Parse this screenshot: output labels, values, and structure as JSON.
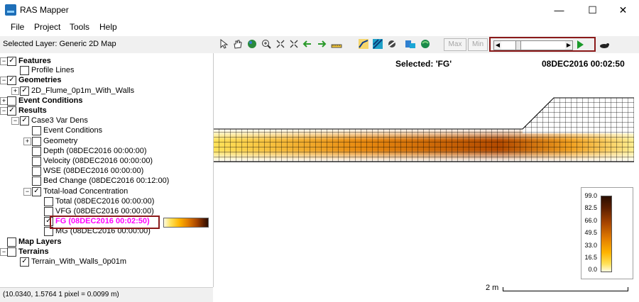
{
  "window": {
    "title": "RAS Mapper",
    "minimize": "—",
    "maximize": "☐",
    "close": "✕"
  },
  "menu": [
    "File",
    "Project",
    "Tools",
    "Help"
  ],
  "toolbar": {
    "selected_layer": "Selected Layer: Generic 2D Map",
    "max_label": "Max",
    "min_label": "Min"
  },
  "tree": [
    {
      "label": "Features",
      "bold": true,
      "checked": true,
      "expander": "−"
    },
    {
      "label": "Profile Lines",
      "bold": false,
      "checked": false,
      "expander": ""
    },
    {
      "label": "Geometries",
      "bold": true,
      "checked": true,
      "expander": "−"
    },
    {
      "label": "2D_Flume_0p1m_With_Walls",
      "bold": false,
      "checked": true,
      "expander": "+"
    },
    {
      "label": "Event Conditions",
      "bold": true,
      "checked": false,
      "expander": "+"
    },
    {
      "label": "Results",
      "bold": true,
      "checked": true,
      "expander": "−"
    },
    {
      "label": "Case3 Var Dens",
      "bold": false,
      "checked": true,
      "expander": "−"
    },
    {
      "label": "Event Conditions",
      "bold": false,
      "checked": false,
      "expander": ""
    },
    {
      "label": "Geometry",
      "bold": false,
      "checked": false,
      "expander": "+"
    },
    {
      "label": "Depth (08DEC2016 00:00:00)",
      "bold": false,
      "checked": false,
      "expander": ""
    },
    {
      "label": "Velocity (08DEC2016 00:00:00)",
      "bold": false,
      "checked": false,
      "expander": ""
    },
    {
      "label": "WSE (08DEC2016 00:00:00)",
      "bold": false,
      "checked": false,
      "expander": ""
    },
    {
      "label": "Bed Change (08DEC2016 00:12:00)",
      "bold": false,
      "checked": false,
      "expander": ""
    },
    {
      "label": "Total-load Concentration",
      "bold": false,
      "checked": true,
      "expander": "−"
    },
    {
      "label": "Total (08DEC2016 00:00:00)",
      "bold": false,
      "checked": false,
      "expander": ""
    },
    {
      "label": "VFG (08DEC2016 00:00:00)",
      "bold": false,
      "checked": false,
      "expander": ""
    },
    {
      "label": "FG (08DEC2016 00:02:50)",
      "bold": true,
      "checked": true,
      "expander": "",
      "selected": true
    },
    {
      "label": "MG (08DEC2016 00:00:00)",
      "bold": false,
      "checked": false,
      "expander": ""
    },
    {
      "label": "Map Layers",
      "bold": true,
      "checked": false,
      "expander": ""
    },
    {
      "label": "Terrains",
      "bold": true,
      "checked": false,
      "expander": "−"
    },
    {
      "label": "Terrain_With_Walls_0p01m",
      "bold": false,
      "checked": true,
      "expander": ""
    }
  ],
  "status": {
    "text": "(10.0340, 1.5764  1 pixel = 0.0099 m)"
  },
  "map": {
    "selected": "Selected: 'FG'",
    "time": "08DEC2016 00:02:50",
    "legend_ticks": [
      "99.0",
      "82.5",
      "66.0",
      "49.5",
      "33.0",
      "16.5",
      "0.0"
    ],
    "scale_label": "2 m"
  },
  "colors": {
    "highlight": "#8b1a1a",
    "selected_text": "#ff00ff",
    "accent": "#1e6fb8"
  }
}
